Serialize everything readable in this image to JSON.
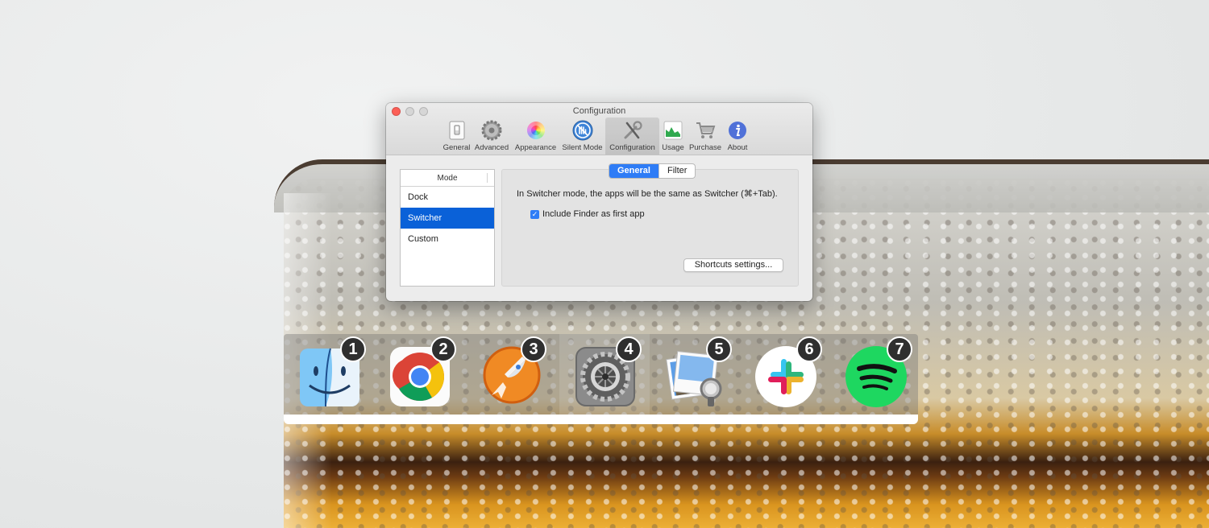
{
  "window": {
    "title": "Configuration",
    "toolbar": [
      {
        "label": "General",
        "icon": "switch-icon"
      },
      {
        "label": "Advanced",
        "icon": "gear-icon"
      },
      {
        "label": "Appearance",
        "icon": "color-wheel-icon"
      },
      {
        "label": "Silent Mode",
        "icon": "hand-stop-icon"
      },
      {
        "label": "Configuration",
        "icon": "tools-icon",
        "active": true
      },
      {
        "label": "Usage",
        "icon": "chart-icon"
      },
      {
        "label": "Purchase",
        "icon": "cart-icon"
      },
      {
        "label": "About",
        "icon": "info-icon"
      }
    ],
    "mode_table": {
      "header": "Mode",
      "rows": [
        "Dock",
        "Switcher",
        "Custom"
      ],
      "selected": "Switcher"
    },
    "tabs": [
      "General",
      "Filter"
    ],
    "active_tab": "General",
    "description": "In Switcher mode, the apps will be the same as Switcher (⌘+Tab).",
    "checkbox": {
      "label": "Include Finder as first app",
      "checked": true
    },
    "shortcuts_button": "Shortcuts settings..."
  },
  "switcher": {
    "apps": [
      {
        "number": "1",
        "icon": "finder-icon"
      },
      {
        "number": "2",
        "icon": "chrome-icon"
      },
      {
        "number": "3",
        "icon": "rocket-icon"
      },
      {
        "number": "4",
        "icon": "system-preferences-icon",
        "active": true
      },
      {
        "number": "5",
        "icon": "preview-icon"
      },
      {
        "number": "6",
        "icon": "slack-icon"
      },
      {
        "number": "7",
        "icon": "spotify-icon"
      }
    ]
  },
  "colors": {
    "accent": "#0a61d8",
    "close_light": "#fc5f57",
    "badge": "#2f2f2f"
  }
}
